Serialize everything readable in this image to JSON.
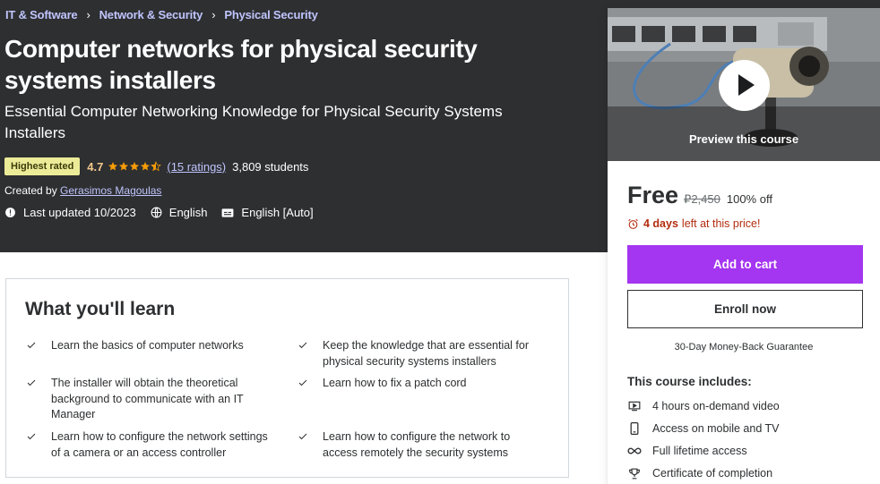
{
  "breadcrumb": [
    "IT & Software",
    "Network & Security",
    "Physical Security"
  ],
  "course": {
    "title": "Computer networks for physical security systems installers",
    "subtitle": "Essential Computer Networking Knowledge for Physical Security Systems Installers",
    "badge": "Highest rated",
    "rating": "4.7",
    "stars": 4.5,
    "ratings_count": "(15 ratings)",
    "students": "3,809 students",
    "created_by_label": "Created by",
    "instructor": "Gerasimos Magoulas",
    "last_updated": "Last updated 10/2023",
    "language": "English",
    "captions": "English [Auto]"
  },
  "learn": {
    "title": "What you'll learn",
    "items": [
      "Learn the basics of computer networks",
      "Keep the knowledge that are essential for physical security systems installers",
      "The installer will obtain the theoretical background to communicate with an IT Manager",
      "Learn how to fix a patch cord",
      "Learn how to configure the network settings of a camera or an access controller",
      "Learn how to configure the network to access remotely the security systems"
    ]
  },
  "sidebar": {
    "preview_label": "Preview this course",
    "price": "Free",
    "original_price": "₽2,450",
    "discount": "100% off",
    "timer_days": "4 days",
    "timer_text": "left at this price!",
    "add_to_cart": "Add to cart",
    "enroll_now": "Enroll now",
    "guarantee": "30-Day Money-Back Guarantee",
    "includes_title": "This course includes:",
    "includes": [
      {
        "icon": "video-icon",
        "text": "4 hours on-demand video"
      },
      {
        "icon": "mobile-icon",
        "text": "Access on mobile and TV"
      },
      {
        "icon": "infinity-icon",
        "text": "Full lifetime access"
      },
      {
        "icon": "trophy-icon",
        "text": "Certificate of completion"
      }
    ]
  },
  "colors": {
    "hero_bg": "#2d2f31",
    "link": "#c0c4fc",
    "accent_purple": "#a435f0",
    "badge_bg": "#eceb98",
    "star": "#f69c08",
    "timer": "#b32d0f"
  }
}
